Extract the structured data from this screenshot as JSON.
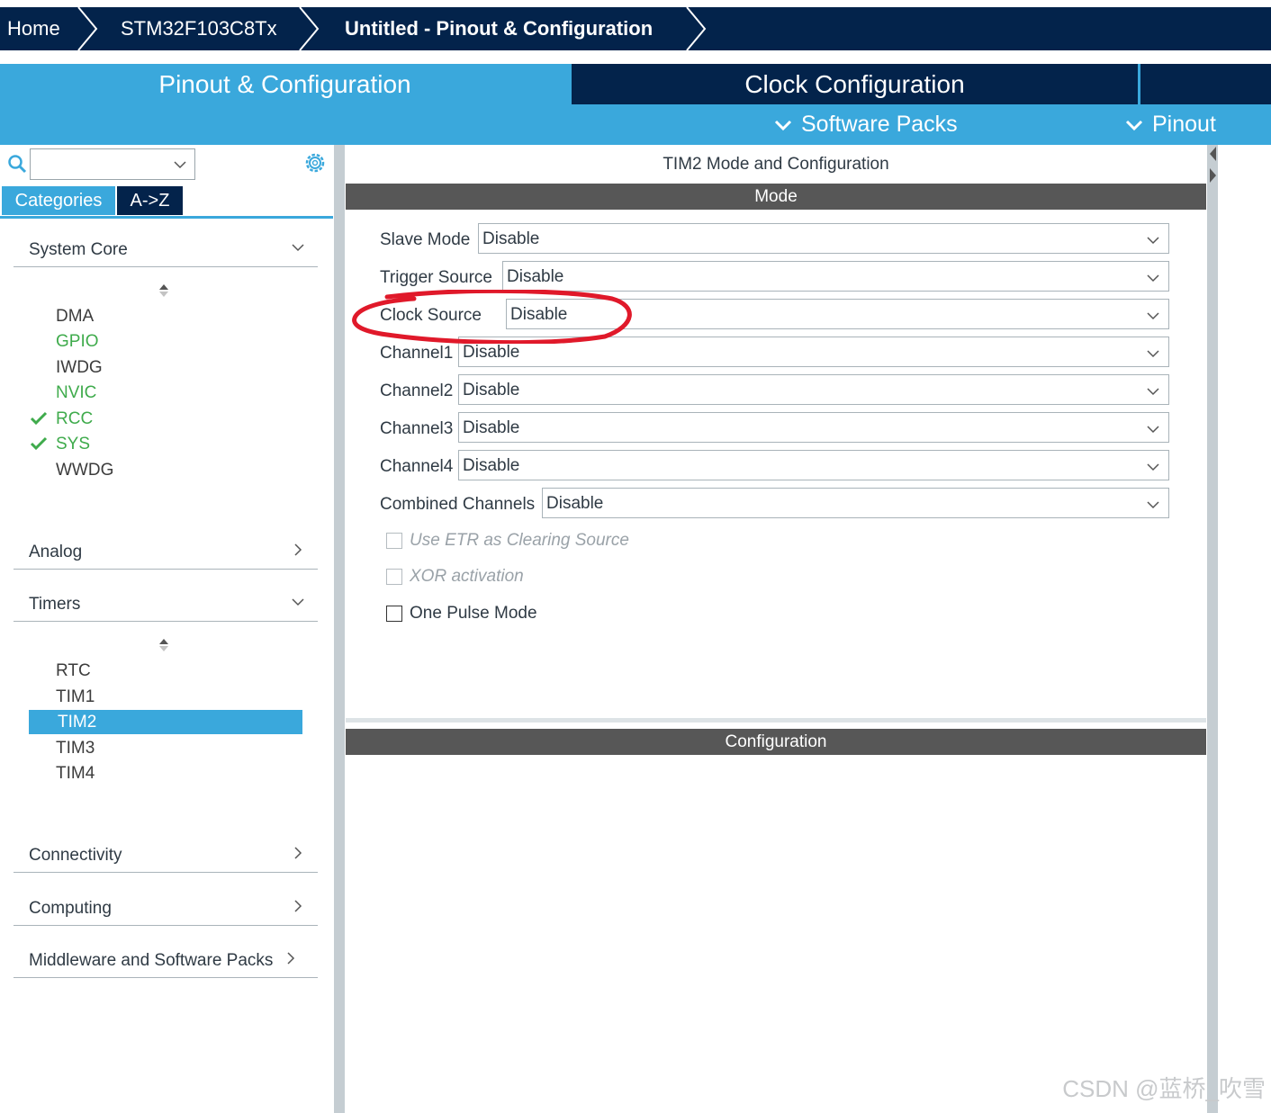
{
  "breadcrumb": {
    "items": [
      "Home",
      "STM32F103C8Tx",
      "Untitled - Pinout & Configuration"
    ]
  },
  "tabs": {
    "pinout": "Pinout & Configuration",
    "clock": "Clock Configuration"
  },
  "menus": {
    "software_packs": "Software Packs",
    "pinout": "Pinout"
  },
  "sidebar": {
    "search": {
      "value": "",
      "icon": "search-icon",
      "settings_icon": "gear-icon"
    },
    "view_tabs": [
      "Categories",
      "A->Z"
    ],
    "system_core": {
      "label": "System Core",
      "items": [
        {
          "label": "DMA",
          "state": "normal"
        },
        {
          "label": "GPIO",
          "state": "green"
        },
        {
          "label": "IWDG",
          "state": "normal"
        },
        {
          "label": "NVIC",
          "state": "green"
        },
        {
          "label": "RCC",
          "state": "checked"
        },
        {
          "label": "SYS",
          "state": "checked"
        },
        {
          "label": "WWDG",
          "state": "normal"
        }
      ]
    },
    "analog": {
      "label": "Analog"
    },
    "timers": {
      "label": "Timers",
      "items": [
        "RTC",
        "TIM1",
        "TIM2",
        "TIM3",
        "TIM4"
      ],
      "selected": "TIM2"
    },
    "connectivity": {
      "label": "Connectivity"
    },
    "computing": {
      "label": "Computing"
    },
    "middleware": {
      "label": "Middleware and Software Packs"
    }
  },
  "panel": {
    "title": "TIM2 Mode and Configuration",
    "mode_header": "Mode",
    "config_header": "Configuration",
    "fields": [
      {
        "label": "Slave Mode",
        "value": "Disable"
      },
      {
        "label": "Trigger Source",
        "value": "Disable"
      },
      {
        "label": "Clock Source",
        "value": "Disable"
      },
      {
        "label": "Channel1",
        "value": "Disable"
      },
      {
        "label": "Channel2",
        "value": "Disable"
      },
      {
        "label": "Channel3",
        "value": "Disable"
      },
      {
        "label": "Channel4",
        "value": "Disable"
      },
      {
        "label": "Combined Channels",
        "value": "Disable"
      }
    ],
    "checkboxes": [
      {
        "label": "Use ETR as Clearing Source",
        "enabled": false,
        "checked": false
      },
      {
        "label": "XOR activation",
        "enabled": false,
        "checked": false
      },
      {
        "label": "One Pulse Mode",
        "enabled": true,
        "checked": false
      }
    ]
  },
  "colors": {
    "navy": "#03234b",
    "accent": "#3aa8dc",
    "green": "#3fab4c",
    "header_bar": "#575757",
    "annotation_red": "#e0192a"
  },
  "watermark": "CSDN @蓝桥_吹雪"
}
